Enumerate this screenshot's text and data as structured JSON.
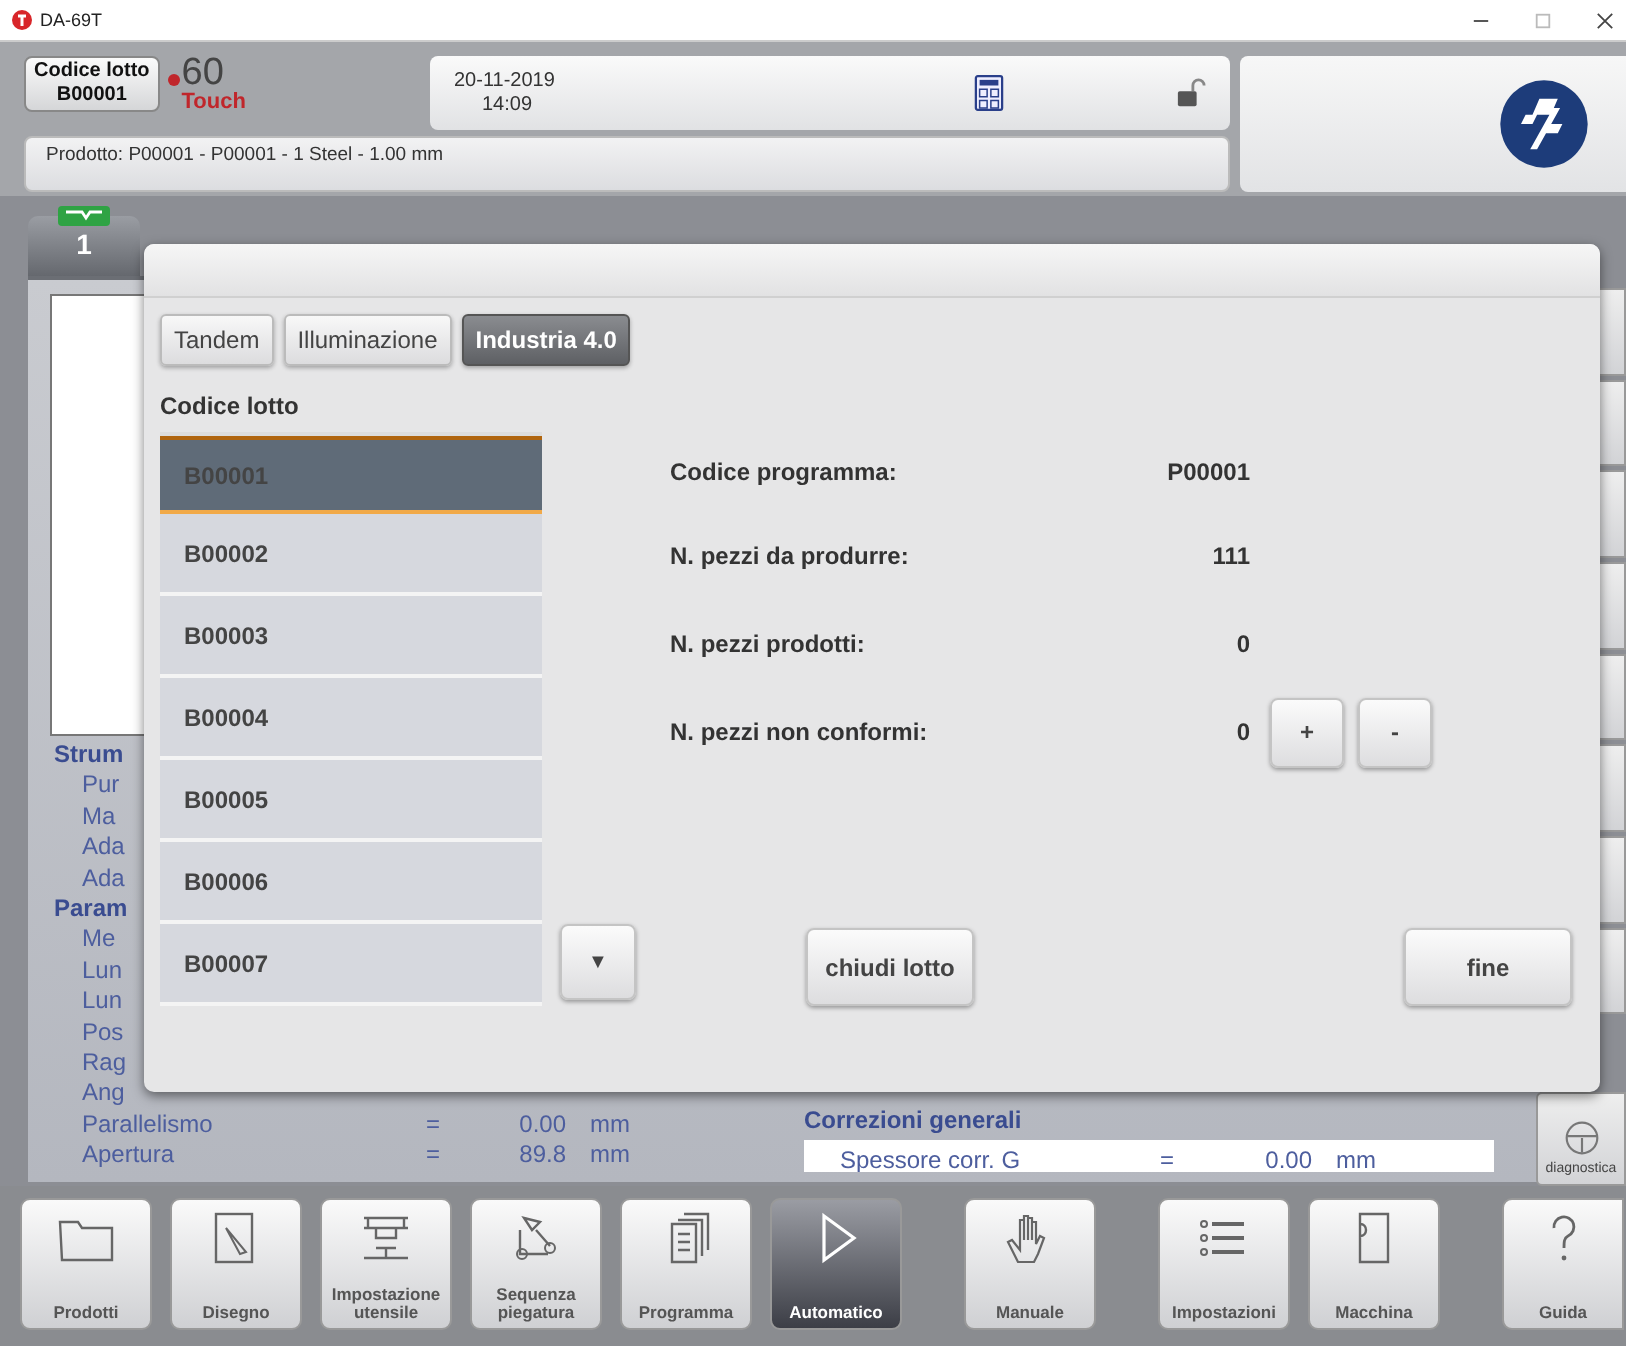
{
  "window": {
    "title": "DA-69T"
  },
  "header": {
    "lot_badge": {
      "label": "Codice lotto",
      "value": "B00001"
    },
    "brand": {
      "number": "60",
      "word": "Touch"
    },
    "date": "20-11-2019",
    "time": "14:09",
    "product": "Prodotto: P00001 - P00001 - 1 Steel - 1.00 mm"
  },
  "program_tab": {
    "label": "1"
  },
  "background": {
    "params": [
      {
        "kind": "section",
        "name": "Strum"
      },
      {
        "kind": "item",
        "name": "Pur"
      },
      {
        "kind": "item",
        "name": "Ma"
      },
      {
        "kind": "item",
        "name": "Ada"
      },
      {
        "kind": "item",
        "name": "Ada"
      },
      {
        "kind": "section",
        "name": "Param"
      },
      {
        "kind": "item",
        "name": "Me"
      },
      {
        "kind": "item",
        "name": "Lun"
      },
      {
        "kind": "item",
        "name": "Lun"
      },
      {
        "kind": "item",
        "name": "Pos"
      },
      {
        "kind": "item",
        "name": "Rag"
      },
      {
        "kind": "item",
        "name": "Ang"
      },
      {
        "kind": "value",
        "name": "Parallelismo",
        "eq": "=",
        "value": "0.00",
        "unit": "mm"
      },
      {
        "kind": "value",
        "name": "Apertura",
        "eq": "=",
        "value": "89.8",
        "unit": "mm"
      }
    ],
    "corrections": {
      "title": "Correzioni generali",
      "row": {
        "name": "Spessore corr. G",
        "eq": "=",
        "value": "0.00",
        "unit": "mm"
      }
    },
    "side_label": "diagnostica"
  },
  "dialog": {
    "tabs": [
      {
        "label": "Tandem",
        "selected": false
      },
      {
        "label": "Illuminazione",
        "selected": false
      },
      {
        "label": "Industria 4.0",
        "selected": true
      }
    ],
    "list_label": "Codice lotto",
    "lots": [
      {
        "code": "B00001",
        "selected": true
      },
      {
        "code": "B00002",
        "selected": false
      },
      {
        "code": "B00003",
        "selected": false
      },
      {
        "code": "B00004",
        "selected": false
      },
      {
        "code": "B00005",
        "selected": false
      },
      {
        "code": "B00006",
        "selected": false
      },
      {
        "code": "B00007",
        "selected": false
      }
    ],
    "scroll_button": "▼",
    "info": [
      {
        "label": "Codice programma:",
        "value": "P00001"
      },
      {
        "label": "N. pezzi da produrre:",
        "value": "111"
      },
      {
        "label": "N. pezzi prodotti:",
        "value": "0"
      },
      {
        "label": "N. pezzi non conformi:",
        "value": "0",
        "buttons": [
          "+",
          "-"
        ]
      }
    ],
    "close_lot": "chiudi lotto",
    "done": "fine"
  },
  "nav": [
    {
      "label": "Prodotti",
      "selected": false
    },
    {
      "label": "Disegno",
      "selected": false
    },
    {
      "label": "Impostazione utensile",
      "selected": false
    },
    {
      "label": "Sequenza piegatura",
      "selected": false
    },
    {
      "label": "Programma",
      "selected": false
    },
    {
      "label": "Automatico",
      "selected": true
    },
    {
      "label": "Manuale",
      "selected": false
    },
    {
      "label": "Impostazioni",
      "selected": false
    },
    {
      "label": "Macchina",
      "selected": false
    },
    {
      "label": "Guida",
      "selected": false
    }
  ]
}
